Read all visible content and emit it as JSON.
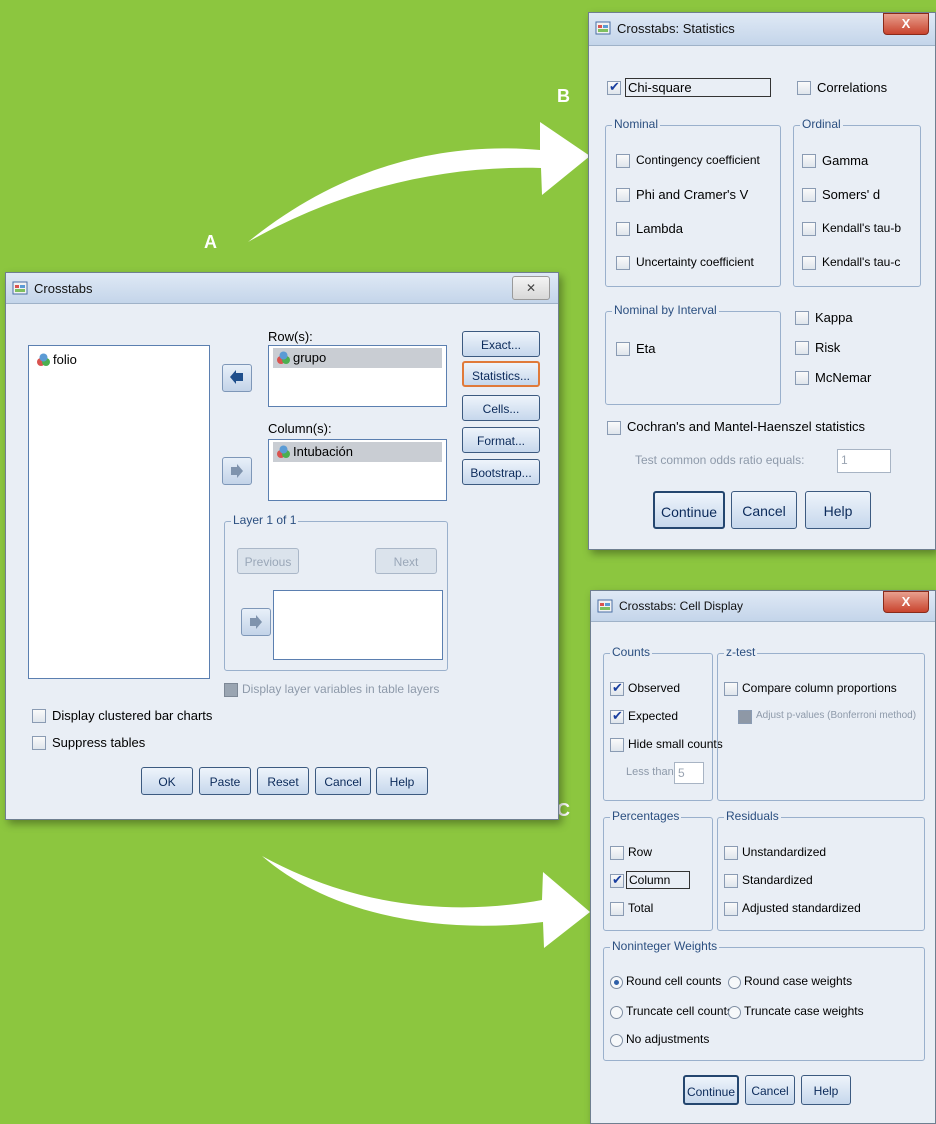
{
  "labels": {
    "a": "A",
    "b": "B",
    "c": "C"
  },
  "crosstabs": {
    "title": "Crosstabs",
    "close": "✕",
    "source_vars": [
      "folio"
    ],
    "rows_label": "Row(s):",
    "rows_vars": [
      "grupo"
    ],
    "columns_label": "Column(s):",
    "columns_vars": [
      "Intubación"
    ],
    "layer_label": "Layer 1 of 1",
    "previous": "Previous",
    "next": "Next",
    "display_layer": "Display layer variables in table layers",
    "clustered": "Display clustered bar charts",
    "suppress": "Suppress tables",
    "side_buttons": [
      "Exact...",
      "Statistics...",
      "Cells...",
      "Format...",
      "Bootstrap..."
    ],
    "bottom_buttons": [
      "OK",
      "Paste",
      "Reset",
      "Cancel",
      "Help"
    ]
  },
  "statistics": {
    "title": "Crosstabs: Statistics",
    "close": "X",
    "chi_square": "Chi-square",
    "correlations": "Correlations",
    "nominal_label": "Nominal",
    "nominal": [
      "Contingency coefficient",
      "Phi and Cramer's V",
      "Lambda",
      "Uncertainty coefficient"
    ],
    "ordinal_label": "Ordinal",
    "ordinal": [
      "Gamma",
      "Somers' d",
      "Kendall's tau-b",
      "Kendall's tau-c"
    ],
    "nbi_label": "Nominal by Interval",
    "eta": "Eta",
    "right_checks": [
      "Kappa",
      "Risk",
      "McNemar"
    ],
    "cmh": "Cochran's and Mantel-Haenszel statistics",
    "odds_label": "Test common odds ratio equals:",
    "odds_value": "1",
    "buttons": [
      "Continue",
      "Cancel",
      "Help"
    ]
  },
  "cells": {
    "title": "Crosstabs: Cell Display",
    "close": "X",
    "counts_label": "Counts",
    "counts": [
      "Observed",
      "Expected",
      "Hide small counts"
    ],
    "less_than": "Less than",
    "less_than_value": "5",
    "ztest_label": "z-test",
    "compare": "Compare column proportions",
    "adjust": "Adjust p-values (Bonferroni method)",
    "percentages_label": "Percentages",
    "percentages": [
      "Row",
      "Column",
      "Total"
    ],
    "residuals_label": "Residuals",
    "residuals": [
      "Unstandardized",
      "Standardized",
      "Adjusted standardized"
    ],
    "weights_label": "Noninteger Weights",
    "weights": [
      "Round cell counts",
      "Round case weights",
      "Truncate cell counts",
      "Truncate case weights",
      "No adjustments"
    ],
    "buttons": [
      "Continue",
      "Cancel",
      "Help"
    ]
  },
  "colors": {
    "background": "#8cc63f",
    "arrow": "#ffffff"
  }
}
